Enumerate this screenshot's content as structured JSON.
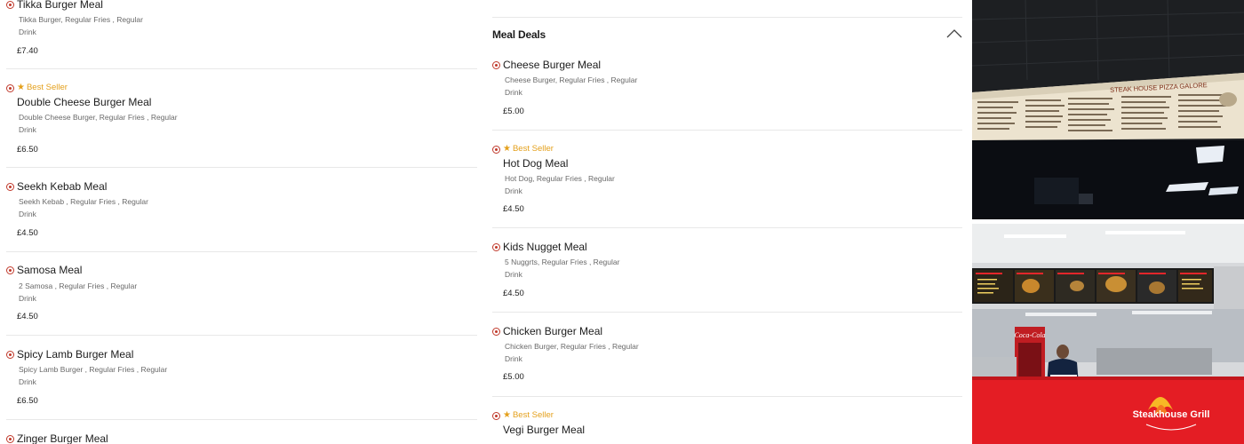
{
  "left_items": [
    {
      "name": "Tikka Burger Meal",
      "desc_line1": "Tikka Burger, Regular Fries , Regular",
      "desc_line2": "Drink",
      "price": "£7.40",
      "best_seller": ""
    },
    {
      "name": "Double Cheese Burger Meal",
      "desc_line1": "Double Cheese Burger, Regular Fries , Regular",
      "desc_line2": "Drink",
      "price": "£6.50",
      "best_seller": "Best Seller"
    },
    {
      "name": "Seekh Kebab Meal",
      "desc_line1": "Seekh Kebab , Regular Fries , Regular",
      "desc_line2": "Drink",
      "price": "£4.50",
      "best_seller": ""
    },
    {
      "name": "Samosa Meal",
      "desc_line1": "2 Samosa , Regular Fries , Regular",
      "desc_line2": "Drink",
      "price": "£4.50",
      "best_seller": ""
    },
    {
      "name": "Spicy Lamb Burger Meal",
      "desc_line1": "Spicy Lamb Burger , Regular Fries , Regular",
      "desc_line2": "Drink",
      "price": "£6.50",
      "best_seller": ""
    },
    {
      "name": "Zinger Burger Meal"
    }
  ],
  "meal_deals": {
    "title": "Meal Deals",
    "collapse_icon": "chevron-up-icon",
    "items": [
      {
        "name": "Cheese Burger Meal",
        "desc_line1": "Cheese Burger, Regular Fries , Regular",
        "desc_line2": "Drink",
        "price": "£5.00",
        "best_seller": ""
      },
      {
        "name": "Hot Dog Meal",
        "desc_line1": "Hot Dog, Regular Fries , Regular",
        "desc_line2": "Drink",
        "price": "£4.50",
        "best_seller": "Best Seller"
      },
      {
        "name": "Kids Nugget Meal",
        "desc_line1": "5 Nuggrts, Regular Fries , Regular",
        "desc_line2": "Drink",
        "price": "£4.50",
        "best_seller": ""
      },
      {
        "name": "Chicken Burger Meal",
        "desc_line1": "Chicken Burger, Regular Fries , Regular",
        "desc_line2": "Drink",
        "price": "£5.00",
        "best_seller": ""
      },
      {
        "name": "Vegi Burger Meal",
        "best_seller": "Best Seller"
      }
    ]
  },
  "photos": {
    "menu_board_sign": "STEAK HOUSE PIZZA GALORE",
    "logo_text": "Steakhouse Grill"
  },
  "colors": {
    "best_seller": "#e4a01c",
    "veg_mark": "#c0392b",
    "divider": "#e8e8e8"
  }
}
